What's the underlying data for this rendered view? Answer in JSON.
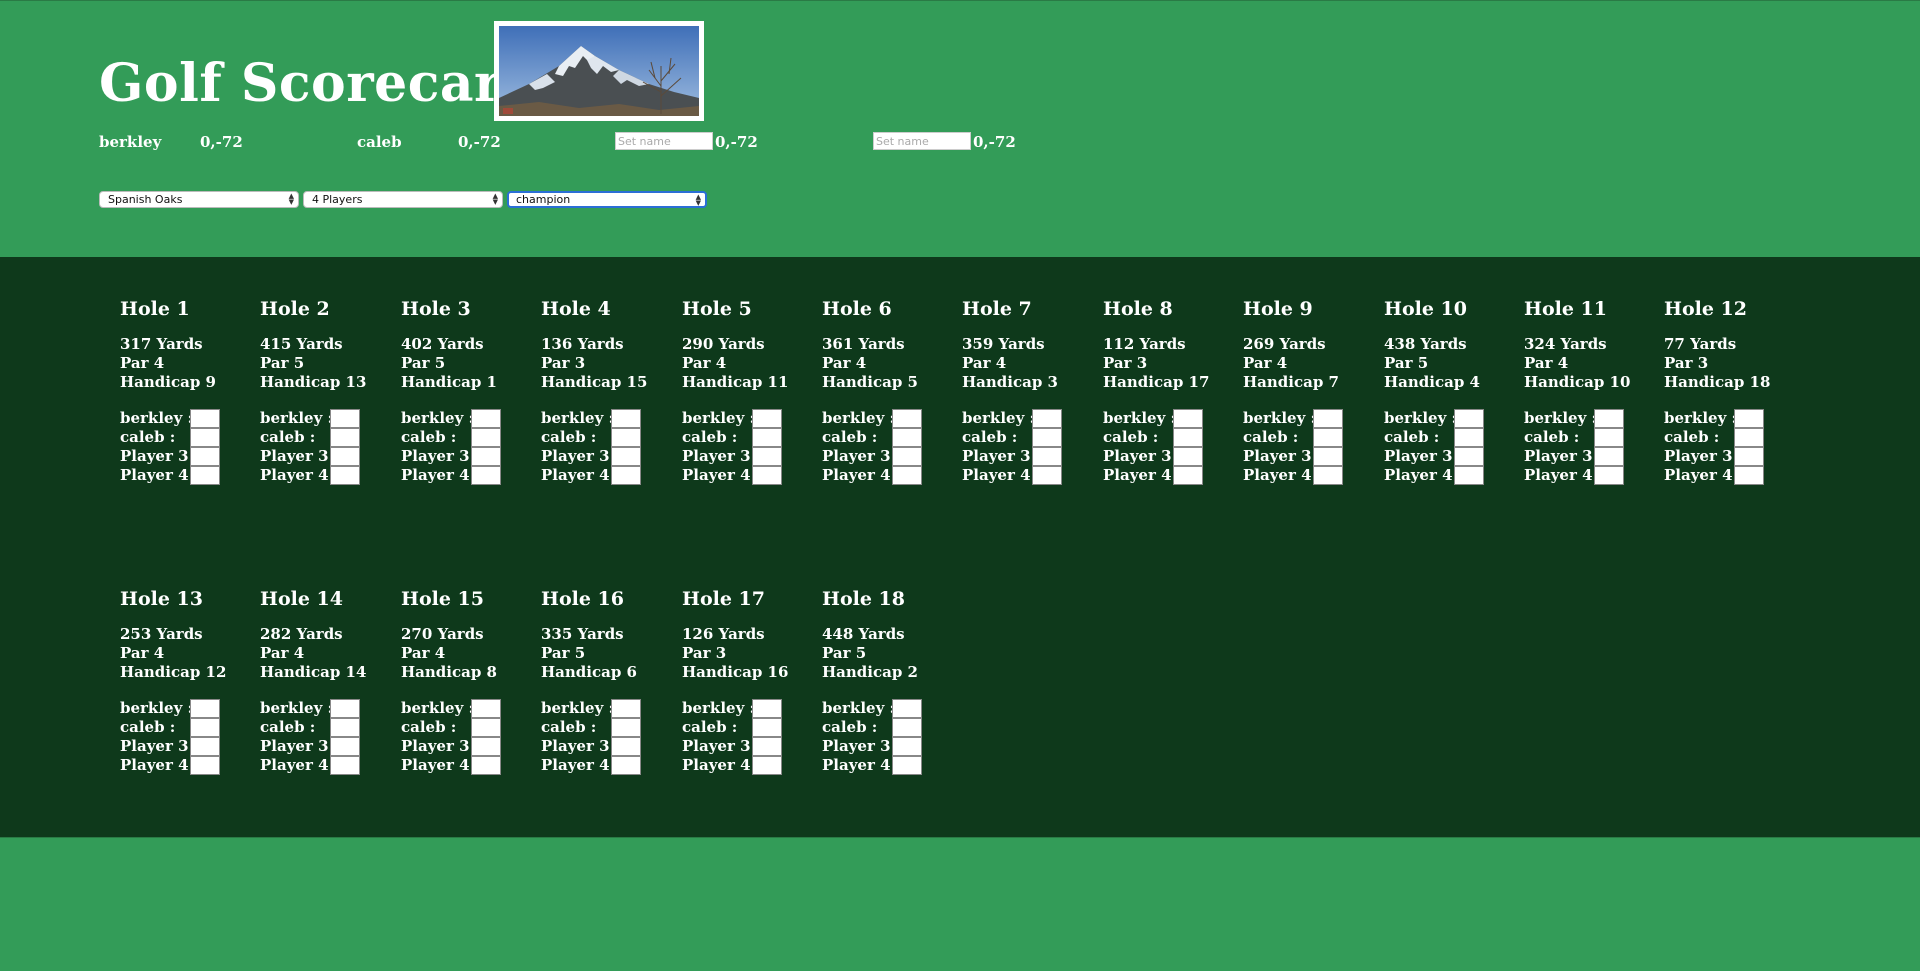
{
  "header": {
    "title": "Golf Scorecard",
    "players": [
      {
        "name": "berkley",
        "score": "0,-72",
        "placeholder": ""
      },
      {
        "name": "caleb",
        "score": "0,-72",
        "placeholder": ""
      },
      {
        "name": "",
        "score": "0,-72",
        "placeholder": "Set name"
      },
      {
        "name": "",
        "score": "0,-72",
        "placeholder": "Set name"
      }
    ],
    "course_select": "Spanish Oaks",
    "players_select": "4 Players",
    "tee_select": "champion"
  },
  "score_labels": [
    "berkley :",
    "caleb :",
    "Player 3 :",
    "Player 4 :"
  ],
  "holes": [
    {
      "title": "Hole 1",
      "yards": "317 Yards",
      "par": "Par 4",
      "handicap": "Handicap 9"
    },
    {
      "title": "Hole 2",
      "yards": "415 Yards",
      "par": "Par 5",
      "handicap": "Handicap 13"
    },
    {
      "title": "Hole 3",
      "yards": "402 Yards",
      "par": "Par 5",
      "handicap": "Handicap 1"
    },
    {
      "title": "Hole 4",
      "yards": "136 Yards",
      "par": "Par 3",
      "handicap": "Handicap 15"
    },
    {
      "title": "Hole 5",
      "yards": "290 Yards",
      "par": "Par 4",
      "handicap": "Handicap 11"
    },
    {
      "title": "Hole 6",
      "yards": "361 Yards",
      "par": "Par 4",
      "handicap": "Handicap 5"
    },
    {
      "title": "Hole 7",
      "yards": "359 Yards",
      "par": "Par 4",
      "handicap": "Handicap 3"
    },
    {
      "title": "Hole 8",
      "yards": "112 Yards",
      "par": "Par 3",
      "handicap": "Handicap 17"
    },
    {
      "title": "Hole 9",
      "yards": "269 Yards",
      "par": "Par 4",
      "handicap": "Handicap 7"
    },
    {
      "title": "Hole 10",
      "yards": "438 Yards",
      "par": "Par 5",
      "handicap": "Handicap 4"
    },
    {
      "title": "Hole 11",
      "yards": "324 Yards",
      "par": "Par 4",
      "handicap": "Handicap 10"
    },
    {
      "title": "Hole 12",
      "yards": "77 Yards",
      "par": "Par 3",
      "handicap": "Handicap 18"
    },
    {
      "title": "Hole 13",
      "yards": "253 Yards",
      "par": "Par 4",
      "handicap": "Handicap 12"
    },
    {
      "title": "Hole 14",
      "yards": "282 Yards",
      "par": "Par 4",
      "handicap": "Handicap 14"
    },
    {
      "title": "Hole 15",
      "yards": "270 Yards",
      "par": "Par 4",
      "handicap": "Handicap 8"
    },
    {
      "title": "Hole 16",
      "yards": "335 Yards",
      "par": "Par 5",
      "handicap": "Handicap 6"
    },
    {
      "title": "Hole 17",
      "yards": "126 Yards",
      "par": "Par 3",
      "handicap": "Handicap 16"
    },
    {
      "title": "Hole 18",
      "yards": "448 Yards",
      "par": "Par 5",
      "handicap": "Handicap 2"
    }
  ],
  "colors": {
    "page_green": "#339c58",
    "panel_dark_green": "#0e391b",
    "focus_blue": "#2b6ed6"
  },
  "photo_icon": "mountain-photo"
}
